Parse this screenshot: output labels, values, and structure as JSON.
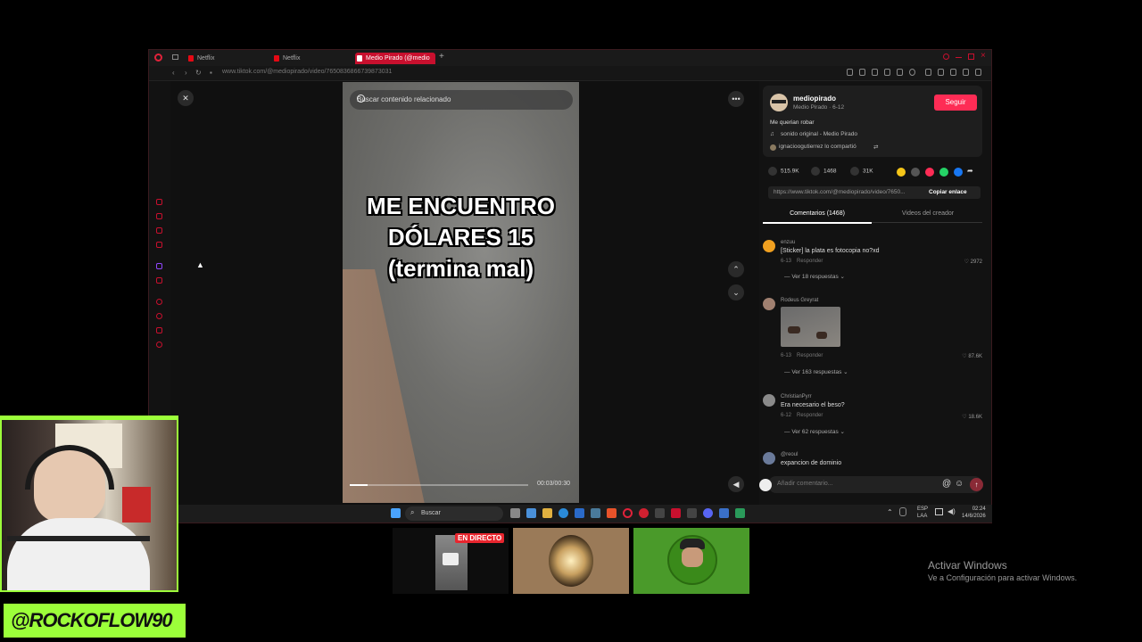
{
  "browser": {
    "tabs": [
      {
        "label": "Netflix",
        "active": false
      },
      {
        "label": "Netflix",
        "active": false
      },
      {
        "label": "Medio Pirado (@medio",
        "active": true
      }
    ],
    "url": "www.tiktok.com/@mediopirado/video/7650836866739873031"
  },
  "video": {
    "search_placeholder": "Buscar contenido relacionado",
    "caption_lines": [
      "ME ENCUENTRO",
      "DÓLARES 15",
      "(termina mal)"
    ],
    "time": "00:03/00:30",
    "progress": 0.1
  },
  "author": {
    "username": "mediopirado",
    "subline": "Medio Pirado · 6-12",
    "follow_label": "Seguir",
    "description": "Me querian robar",
    "sound": "sonido original - Medio Pirado",
    "shared_by": "ignacioogutierrez lo compartió"
  },
  "stats": {
    "likes": "515.9K",
    "comments": "1468",
    "saves": "31K"
  },
  "share_colors": [
    "#f5c518",
    "#555555",
    "#fe2c55",
    "#25d366",
    "#1877f2"
  ],
  "link": {
    "url": "https://www.tiktok.com/@mediopirado/video/7650...",
    "copy_label": "Copiar enlace"
  },
  "panel_tabs": {
    "comments": "Comentarios (1468)",
    "creator": "Videos del creador"
  },
  "comments": [
    {
      "name": "enzuu",
      "text": "[Sticker] la plata es fotocopia no?xd",
      "date": "6-13",
      "reply": "Responder",
      "likes": "2972",
      "replies": "Ver 18 respuestas",
      "avatar_color": "#f0a020"
    },
    {
      "name": "Rodeus Greyrat",
      "text": "",
      "date": "6-13",
      "reply": "Responder",
      "likes": "87.6K",
      "replies": "Ver 163 respuestas",
      "avatar_color": "#a08070"
    },
    {
      "name": "ChristianPyrr",
      "text": "Era necesario el beso?",
      "date": "6-12",
      "reply": "Responder",
      "likes": "18.6K",
      "replies": "Ver 62 respuestas",
      "avatar_color": "#8a8a8a"
    },
    {
      "name": "@reoul",
      "text": "expancion de dominio",
      "avatar_color": "#6a7a9a"
    }
  ],
  "comment_input": {
    "placeholder": "Añadir comentario..."
  },
  "taskbar": {
    "search": "Buscar",
    "lang1": "ESP",
    "lang2": "LAA",
    "time": "02:24",
    "date": "14/6/2026"
  },
  "overlay": {
    "handle": "@ROCKOFLOW90",
    "live_badge": "EN DIRECTO",
    "activate_title": "Activar Windows",
    "activate_sub": "Ve a Configuración para activar Windows."
  }
}
